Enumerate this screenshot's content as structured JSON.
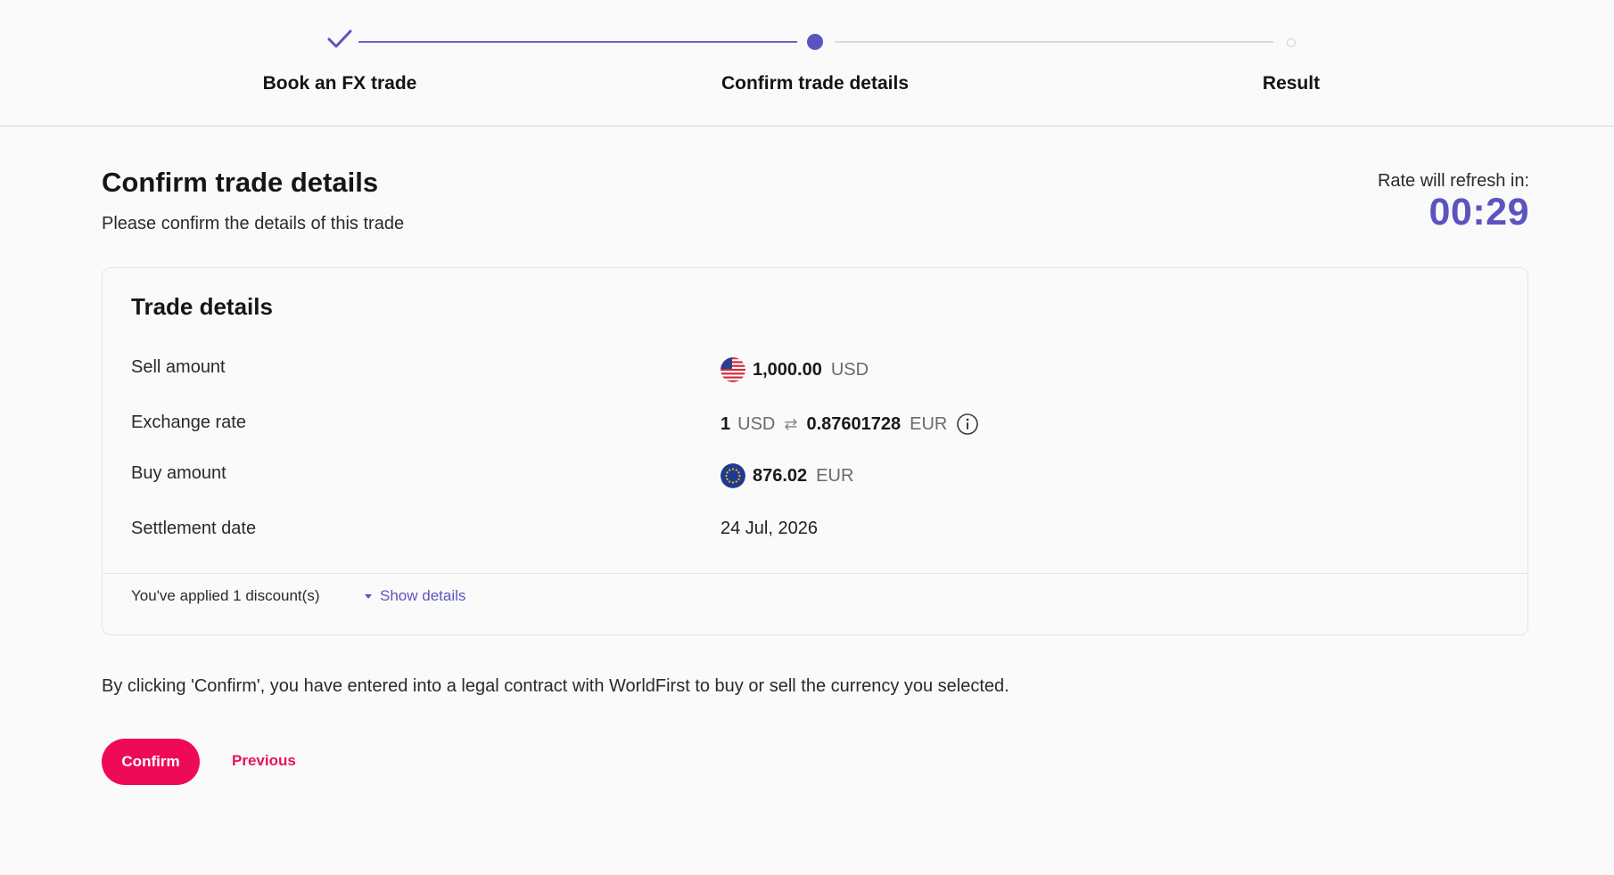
{
  "stepper": {
    "steps": [
      {
        "label": "Book an FX trade",
        "state": "complete"
      },
      {
        "label": "Confirm trade details",
        "state": "current"
      },
      {
        "label": "Result",
        "state": "upcoming"
      }
    ],
    "active_color": "#5b54c0",
    "inactive_color": "#d9d9d9"
  },
  "header": {
    "title": "Confirm trade details",
    "subtitle": "Please confirm the details of this trade",
    "refresh_label": "Rate will refresh in:",
    "refresh_timer": "00:29"
  },
  "trade": {
    "title": "Trade details",
    "sell": {
      "label": "Sell amount",
      "amount": "1,000.00",
      "currency": "USD",
      "flag": "us-flag-icon"
    },
    "rate": {
      "label": "Exchange rate",
      "from_amount": "1",
      "from_currency": "USD",
      "swap_symbol": "⇄",
      "to_amount": "0.87601728",
      "to_currency": "EUR",
      "info_icon": "info-icon"
    },
    "buy": {
      "label": "Buy amount",
      "amount": "876.02",
      "currency": "EUR",
      "flag": "eu-flag-icon"
    },
    "settlement": {
      "label": "Settlement date",
      "value": "24 Jul, 2026"
    }
  },
  "discount": {
    "text": "You've applied 1 discount(s)",
    "toggle_label": "Show details"
  },
  "footer": {
    "legal": "By clicking 'Confirm', you have entered into a legal contract with WorldFirst to buy or sell the currency you selected.",
    "confirm_label": "Confirm",
    "previous_label": "Previous"
  },
  "colors": {
    "brand_pink": "#ef0a56",
    "accent_purple": "#5b54c0"
  }
}
